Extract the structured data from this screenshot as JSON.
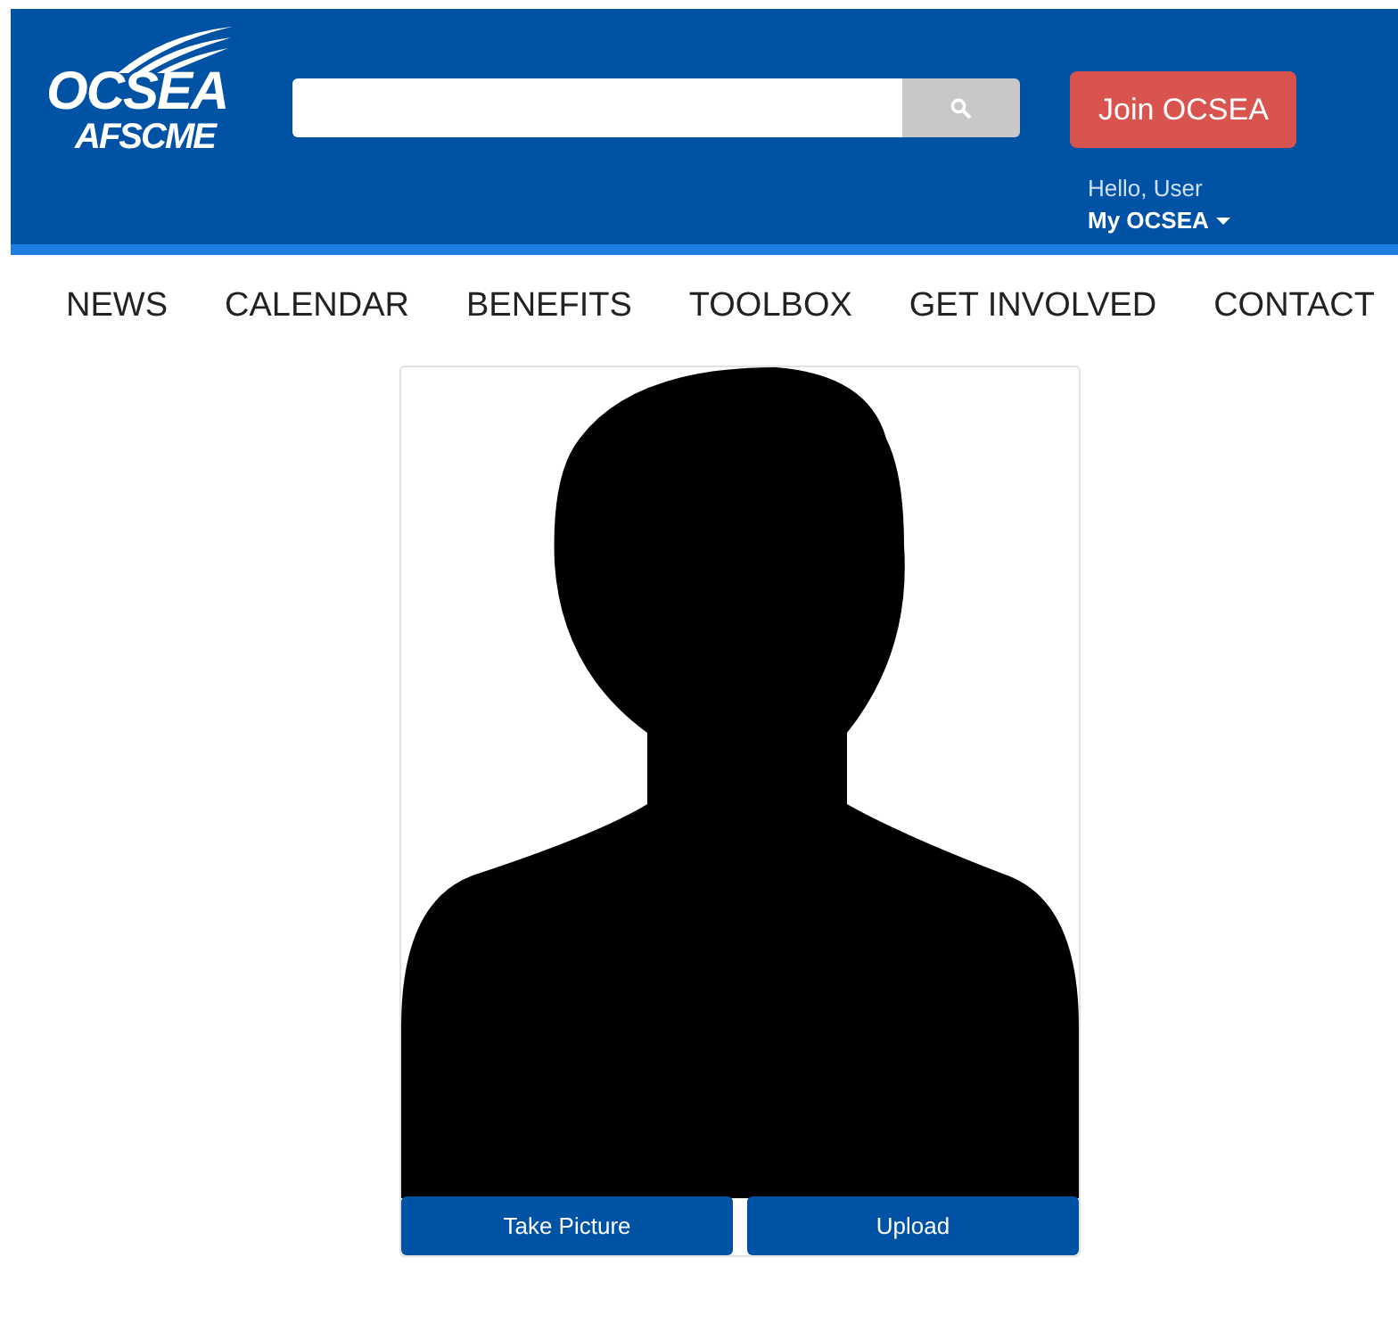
{
  "header": {
    "logo": {
      "line_1": "OCSEA",
      "line_2": "AFSCME"
    },
    "join_button": "Join OCSEA",
    "greeting": "Hello, User",
    "account_menu": "My OCSEA"
  },
  "nav": [
    {
      "label": "NEWS"
    },
    {
      "label": "CALENDAR"
    },
    {
      "label": "BENEFITS"
    },
    {
      "label": "TOOLBOX"
    },
    {
      "label": "GET INVOLVED"
    },
    {
      "label": "CONTACT"
    }
  ],
  "photo_card": {
    "buttons": [
      "Take Picture",
      "Upload"
    ]
  }
}
